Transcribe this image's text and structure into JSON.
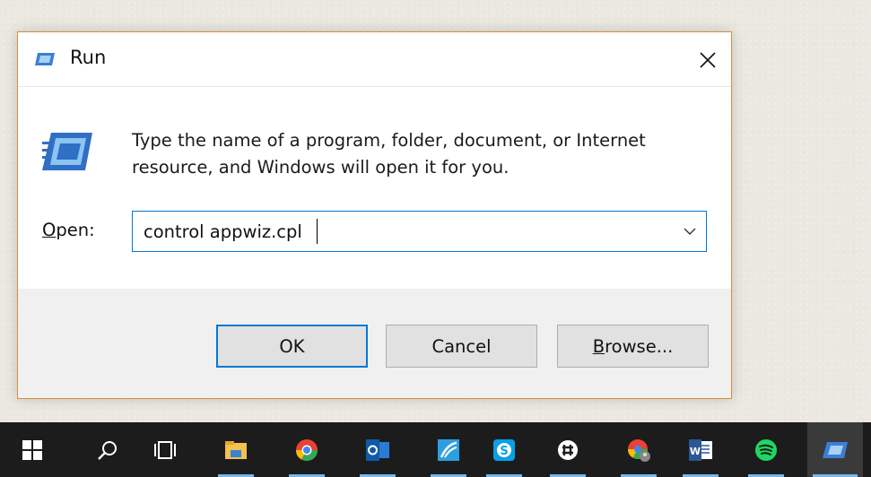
{
  "dialog": {
    "title": "Run",
    "description": "Type the name of a program, folder, document, or Internet resource, and Windows will open it for you.",
    "open_label_mnemonic": "O",
    "open_label_rest": "pen:",
    "open_value": "control appwiz.cpl",
    "buttons": {
      "ok": "OK",
      "cancel": "Cancel",
      "browse_mnemonic": "B",
      "browse_rest": "rowse..."
    }
  },
  "taskbar": {
    "items": [
      {
        "icon": "windows-start-icon"
      },
      {
        "icon": "search-icon"
      },
      {
        "icon": "task-view-icon"
      },
      {
        "icon": "file-explorer-icon",
        "active": true
      },
      {
        "icon": "chrome-icon",
        "active": true
      },
      {
        "icon": "outlook-icon",
        "active": true
      },
      {
        "icon": "remote-desktop-icon",
        "active": true
      },
      {
        "icon": "skype-icon",
        "active": true
      },
      {
        "icon": "slack-icon",
        "active": true
      },
      {
        "icon": "chrome-profile-icon",
        "active": true
      },
      {
        "icon": "word-icon",
        "active": true
      },
      {
        "icon": "spotify-icon",
        "active": true
      },
      {
        "icon": "run-icon",
        "active": true
      }
    ]
  },
  "colors": {
    "accent": "#0078d7",
    "dialog_border": "#d98a3f",
    "taskbar_bg": "#1c1c1c",
    "footer_bg": "#f0f0f0"
  }
}
